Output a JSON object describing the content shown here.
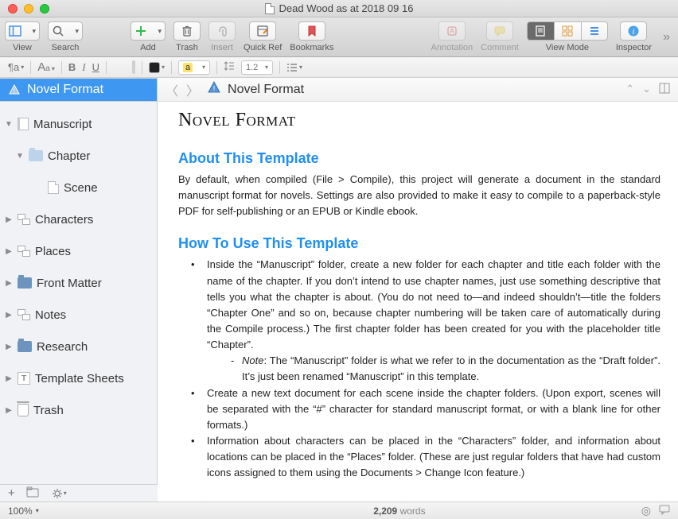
{
  "window": {
    "title": "Dead Wood as at 2018 09 16"
  },
  "toolbar": {
    "view": "View",
    "search": "Search",
    "add": "Add",
    "trash": "Trash",
    "insert": "Insert",
    "quickref": "Quick Ref",
    "bookmarks": "Bookmarks",
    "annotation": "Annotation",
    "comment": "Comment",
    "viewmode": "View Mode",
    "inspector": "Inspector"
  },
  "formatbar": {
    "highlight": "a",
    "linespacing": "1.2"
  },
  "binder": {
    "title": "Novel Format",
    "items": [
      {
        "label": "Manuscript",
        "icon": "book",
        "exp": true,
        "lvl": 0
      },
      {
        "label": "Chapter",
        "icon": "folder-pale",
        "exp": true,
        "lvl": 1
      },
      {
        "label": "Scene",
        "icon": "doc",
        "exp": null,
        "lvl": 2
      },
      {
        "label": "Characters",
        "icon": "cards",
        "exp": false,
        "lvl": 0
      },
      {
        "label": "Places",
        "icon": "cards",
        "exp": false,
        "lvl": 0
      },
      {
        "label": "Front Matter",
        "icon": "folder-dark",
        "exp": false,
        "lvl": 0
      },
      {
        "label": "Notes",
        "icon": "cards",
        "exp": false,
        "lvl": 0
      },
      {
        "label": "Research",
        "icon": "folder-dark",
        "exp": false,
        "lvl": 0
      },
      {
        "label": "Template Sheets",
        "icon": "temp",
        "exp": false,
        "lvl": 0
      },
      {
        "label": "Trash",
        "icon": "trash",
        "exp": false,
        "lvl": 0
      }
    ]
  },
  "editor": {
    "path_title": "Novel Format",
    "doc_title": "Novel Format",
    "h_about": "About This Template",
    "p_about": "By default, when compiled (File > Compile), this project will generate a document in the standard manuscript format for novels. Settings are also provided to make it easy to compile to a paperback-style PDF for self-publishing or an EPUB or Kindle ebook.",
    "h_howto": "How To Use This Template",
    "li1": "Inside the “Manuscript” folder, create a new folder for each chapter and title each folder with the name of the chapter. If you don’t intend to use chapter names, just use something descriptive that tells you what the chapter is about. (You do not need to—and indeed shouldn’t—title the folders “Chapter One” and so on, because chapter numbering will be taken care of automatically during the Compile process.) The first chapter folder has been created for you with the placeholder title “Chapter”.",
    "li1_note_label": "Note",
    "li1_note": ": The “Manuscript” folder is what we refer to in the documentation as the “Draft folder”. It’s just been renamed “Manuscript” in this template.",
    "li2": "Create a new text document for each scene inside the chapter folders. (Upon export, scenes will be separated with the “#” character for standard manuscript format, or with a blank line for other formats.)",
    "li3": "Information about characters can be placed in the “Characters” folder, and information about locations can be placed in the “Places” folder. (These are just regular folders that have had custom icons assigned to them using the Documents > Change Icon feature.)"
  },
  "status": {
    "zoom": "100%",
    "words_count": "2,209",
    "words_label": "words"
  }
}
